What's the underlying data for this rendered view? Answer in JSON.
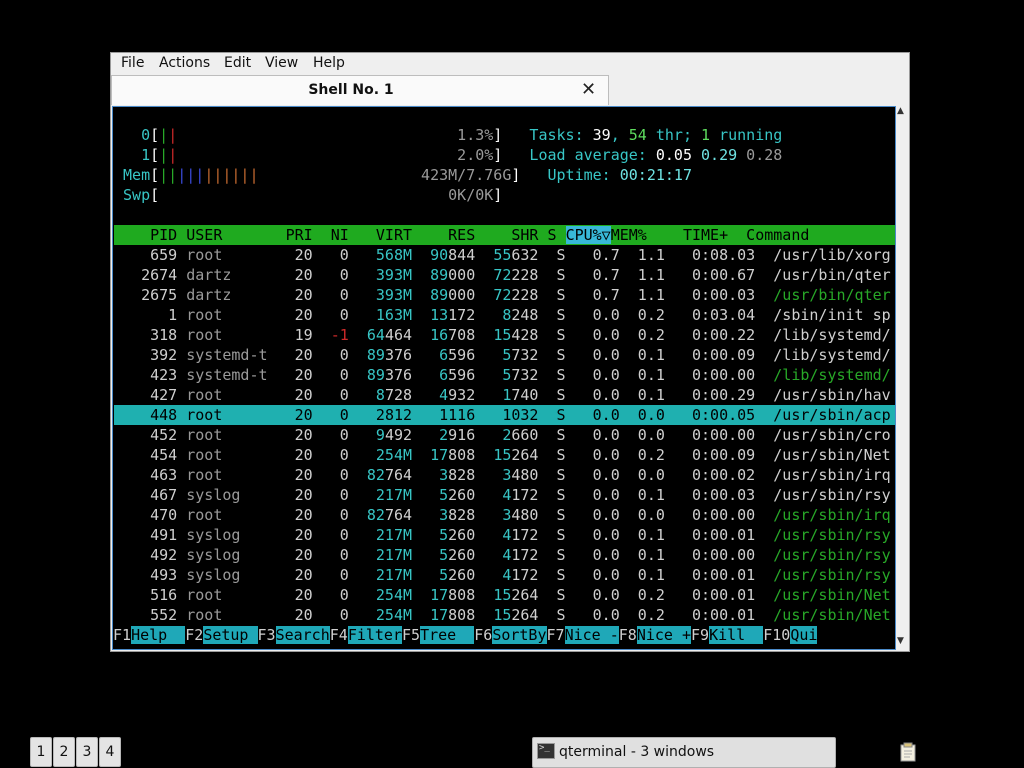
{
  "menubar": {
    "items": [
      "File",
      "Actions",
      "Edit",
      "View",
      "Help"
    ]
  },
  "tab": {
    "title": "Shell No. 1",
    "close_glyph": "✕"
  },
  "htop": {
    "cpu0": {
      "label": "0",
      "pct": "1.3%"
    },
    "cpu1": {
      "label": "1",
      "pct": "2.0%"
    },
    "mem": {
      "label": "Mem",
      "value": "423M/7.76G"
    },
    "swp": {
      "label": "Swp",
      "value": "0K/0K"
    },
    "tasks": {
      "label": "Tasks:",
      "count": "39",
      "thr": "54",
      "thr_label": "thr;",
      "running": "1",
      "running_label": "running"
    },
    "load": {
      "label": "Load average:",
      "v1": "0.05",
      "v5": "0.29",
      "v15": "0.28"
    },
    "uptime": {
      "label": "Uptime:",
      "value": "00:21:17"
    },
    "columns": [
      "PID",
      "USER",
      "PRI",
      "NI",
      "VIRT",
      "RES",
      "SHR",
      "S",
      "CPU%▽",
      "MEM%",
      "TIME+",
      "Command"
    ],
    "rows": [
      {
        "pid": "659",
        "user": "root",
        "pri": "20",
        "ni": "0",
        "virt": "568M",
        "res": "90844",
        "shr": "55632",
        "s": "S",
        "cpu": "0.7",
        "mem": "1.1",
        "time": "0:08.03",
        "cmd": "/usr/lib/xorg"
      },
      {
        "pid": "2674",
        "user": "dartz",
        "pri": "20",
        "ni": "0",
        "virt": "393M",
        "res": "89000",
        "shr": "72228",
        "s": "S",
        "cpu": "0.7",
        "mem": "1.1",
        "time": "0:00.67",
        "cmd": "/usr/bin/qter"
      },
      {
        "pid": "2675",
        "user": "dartz",
        "pri": "20",
        "ni": "0",
        "virt": "393M",
        "res": "89000",
        "shr": "72228",
        "s": "S",
        "cpu": "0.7",
        "mem": "1.1",
        "time": "0:00.03",
        "cmd": "/usr/bin/qter"
      },
      {
        "pid": "1",
        "user": "root",
        "pri": "20",
        "ni": "0",
        "virt": "163M",
        "res": "13172",
        "shr": "8248",
        "s": "S",
        "cpu": "0.0",
        "mem": "0.2",
        "time": "0:03.04",
        "cmd": "/sbin/init sp"
      },
      {
        "pid": "318",
        "user": "root",
        "pri": "19",
        "ni": "-1",
        "virt": "64464",
        "res": "16708",
        "shr": "15428",
        "s": "S",
        "cpu": "0.0",
        "mem": "0.2",
        "time": "0:00.22",
        "cmd": "/lib/systemd/"
      },
      {
        "pid": "392",
        "user": "systemd-t",
        "pri": "20",
        "ni": "0",
        "virt": "89376",
        "res": "6596",
        "shr": "5732",
        "s": "S",
        "cpu": "0.0",
        "mem": "0.1",
        "time": "0:00.09",
        "cmd": "/lib/systemd/"
      },
      {
        "pid": "423",
        "user": "systemd-t",
        "pri": "20",
        "ni": "0",
        "virt": "89376",
        "res": "6596",
        "shr": "5732",
        "s": "S",
        "cpu": "0.0",
        "mem": "0.1",
        "time": "0:00.00",
        "cmd": "/lib/systemd/"
      },
      {
        "pid": "427",
        "user": "root",
        "pri": "20",
        "ni": "0",
        "virt": "8728",
        "res": "4932",
        "shr": "1740",
        "s": "S",
        "cpu": "0.0",
        "mem": "0.1",
        "time": "0:00.29",
        "cmd": "/usr/sbin/hav"
      },
      {
        "pid": "448",
        "user": "root",
        "pri": "20",
        "ni": "0",
        "virt": "2812",
        "res": "1116",
        "shr": "1032",
        "s": "S",
        "cpu": "0.0",
        "mem": "0.0",
        "time": "0:00.05",
        "cmd": "/usr/sbin/acp"
      },
      {
        "pid": "452",
        "user": "root",
        "pri": "20",
        "ni": "0",
        "virt": "9492",
        "res": "2916",
        "shr": "2660",
        "s": "S",
        "cpu": "0.0",
        "mem": "0.0",
        "time": "0:00.00",
        "cmd": "/usr/sbin/cro"
      },
      {
        "pid": "454",
        "user": "root",
        "pri": "20",
        "ni": "0",
        "virt": "254M",
        "res": "17808",
        "shr": "15264",
        "s": "S",
        "cpu": "0.0",
        "mem": "0.2",
        "time": "0:00.09",
        "cmd": "/usr/sbin/Net"
      },
      {
        "pid": "463",
        "user": "root",
        "pri": "20",
        "ni": "0",
        "virt": "82764",
        "res": "3828",
        "shr": "3480",
        "s": "S",
        "cpu": "0.0",
        "mem": "0.0",
        "time": "0:00.02",
        "cmd": "/usr/sbin/irq"
      },
      {
        "pid": "467",
        "user": "syslog",
        "pri": "20",
        "ni": "0",
        "virt": "217M",
        "res": "5260",
        "shr": "4172",
        "s": "S",
        "cpu": "0.0",
        "mem": "0.1",
        "time": "0:00.03",
        "cmd": "/usr/sbin/rsy"
      },
      {
        "pid": "470",
        "user": "root",
        "pri": "20",
        "ni": "0",
        "virt": "82764",
        "res": "3828",
        "shr": "3480",
        "s": "S",
        "cpu": "0.0",
        "mem": "0.0",
        "time": "0:00.00",
        "cmd": "/usr/sbin/irq"
      },
      {
        "pid": "491",
        "user": "syslog",
        "pri": "20",
        "ni": "0",
        "virt": "217M",
        "res": "5260",
        "shr": "4172",
        "s": "S",
        "cpu": "0.0",
        "mem": "0.1",
        "time": "0:00.01",
        "cmd": "/usr/sbin/rsy"
      },
      {
        "pid": "492",
        "user": "syslog",
        "pri": "20",
        "ni": "0",
        "virt": "217M",
        "res": "5260",
        "shr": "4172",
        "s": "S",
        "cpu": "0.0",
        "mem": "0.1",
        "time": "0:00.00",
        "cmd": "/usr/sbin/rsy"
      },
      {
        "pid": "493",
        "user": "syslog",
        "pri": "20",
        "ni": "0",
        "virt": "217M",
        "res": "5260",
        "shr": "4172",
        "s": "S",
        "cpu": "0.0",
        "mem": "0.1",
        "time": "0:00.01",
        "cmd": "/usr/sbin/rsy"
      },
      {
        "pid": "516",
        "user": "root",
        "pri": "20",
        "ni": "0",
        "virt": "254M",
        "res": "17808",
        "shr": "15264",
        "s": "S",
        "cpu": "0.0",
        "mem": "0.2",
        "time": "0:00.01",
        "cmd": "/usr/sbin/Net"
      },
      {
        "pid": "552",
        "user": "root",
        "pri": "20",
        "ni": "0",
        "virt": "254M",
        "res": "17808",
        "shr": "15264",
        "s": "S",
        "cpu": "0.0",
        "mem": "0.2",
        "time": "0:00.01",
        "cmd": "/usr/sbin/Net"
      }
    ],
    "selected_pid": "448",
    "thread_rows": [
      "2675",
      "423",
      "470",
      "491",
      "492",
      "493",
      "516",
      "552"
    ],
    "fkeys": [
      {
        "key": "F1",
        "label": "Help  "
      },
      {
        "key": "F2",
        "label": "Setup "
      },
      {
        "key": "F3",
        "label": "Search"
      },
      {
        "key": "F4",
        "label": "Filter"
      },
      {
        "key": "F5",
        "label": "Tree  "
      },
      {
        "key": "F6",
        "label": "SortBy"
      },
      {
        "key": "F7",
        "label": "Nice -"
      },
      {
        "key": "F8",
        "label": "Nice +"
      },
      {
        "key": "F9",
        "label": "Kill  "
      },
      {
        "key": "F10",
        "label": "Qui"
      }
    ]
  },
  "taskbar": {
    "workspaces": [
      "1",
      "2",
      "3",
      "4"
    ],
    "task_label": "qterminal - 3 windows",
    "icons": {
      "task": "terminal-icon",
      "tray": "clipboard-icon"
    }
  },
  "colors": {
    "header_bg": "#1faa1f",
    "selected_bg": "#1fb0b0",
    "fkey_bg": "#1fa8b8",
    "terminal_bg": "#000000"
  }
}
